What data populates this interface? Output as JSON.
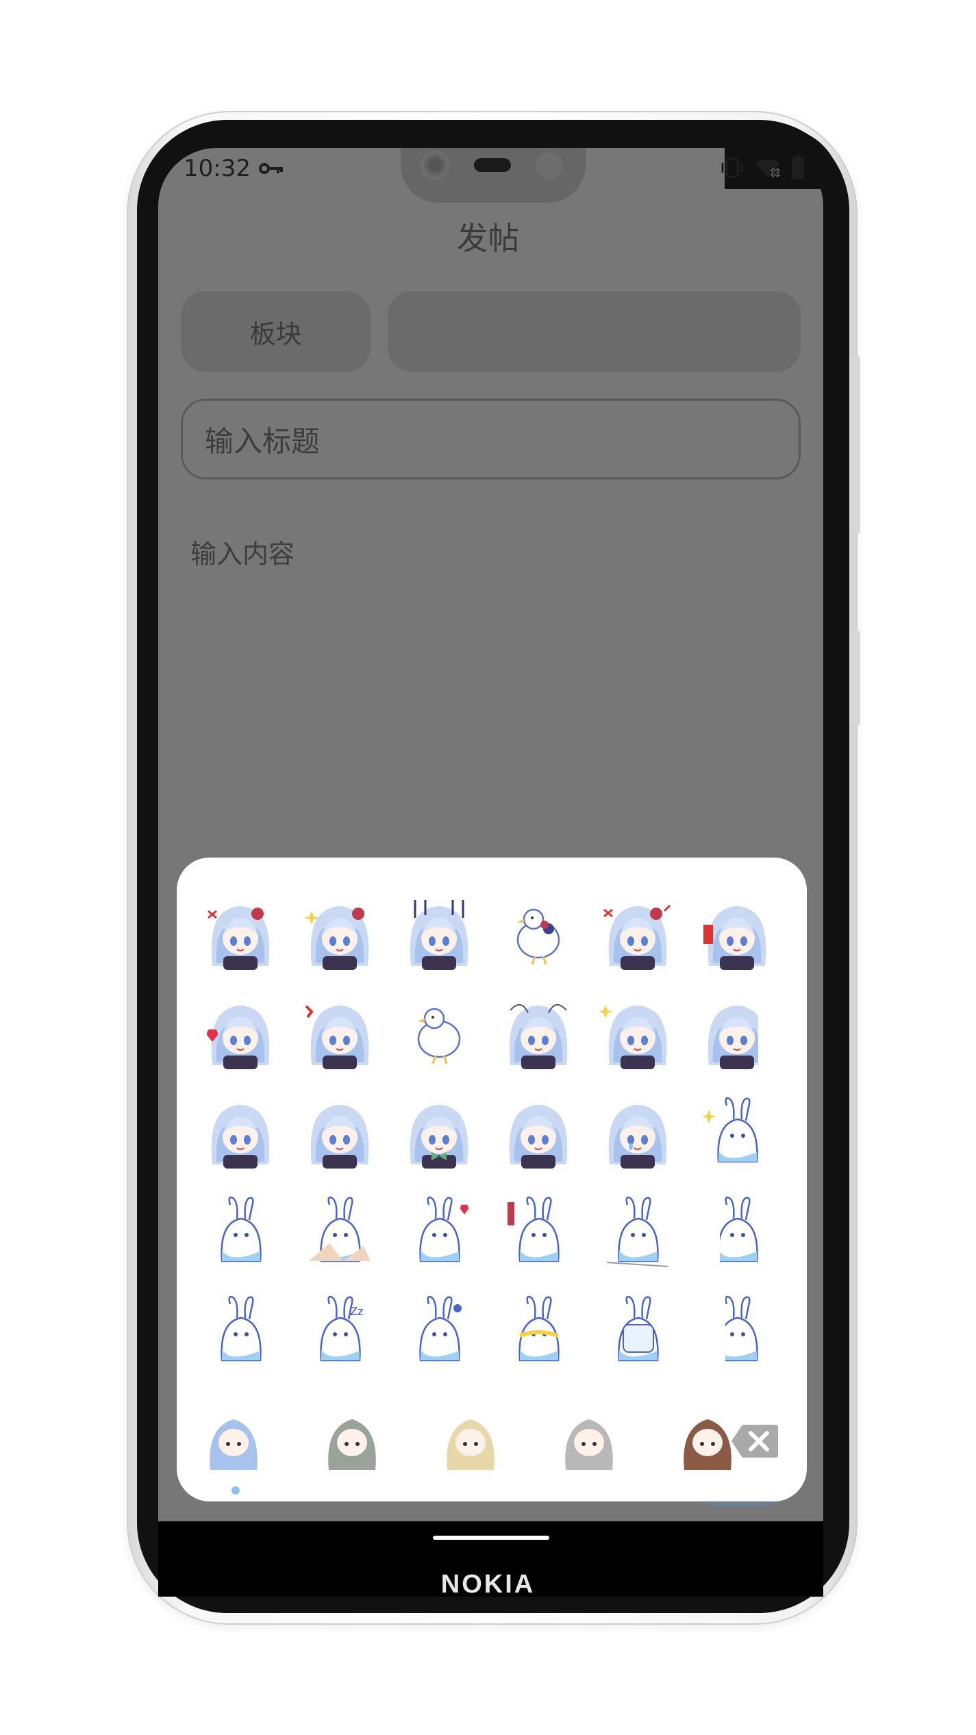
{
  "status_bar": {
    "time": "10:32",
    "icons": [
      "key-icon",
      "vibrate-icon",
      "wifi-off-icon",
      "battery-icon"
    ]
  },
  "header": {
    "title": "发帖"
  },
  "form": {
    "section_label": "板块",
    "title_placeholder": "输入标题",
    "content_placeholder": "输入内容"
  },
  "emoji_panel": {
    "grid_rows": [
      [
        "girl-angry",
        "girl-sparkle",
        "girl-shocked",
        "bird-bow",
        "girl-rage",
        "girl-gift"
      ],
      [
        "girl-heart",
        "girl-excited",
        "bird-plain",
        "girl-tangle",
        "girl-shy",
        "girl-peek"
      ],
      [
        "girl-smile",
        "girl-laugh",
        "girl-bowtie",
        "girl-blush",
        "girl-teary",
        "bunny-wave"
      ],
      [
        "bunny-sit",
        "bunny-crash",
        "bunny-heart",
        "bunny-torch",
        "bunny-stand",
        "bunny-peek"
      ],
      [
        "bunny-face",
        "bunny-sleep",
        "bunny-yawn",
        "bunny-cheer",
        "bunny-cube",
        "bunny-side"
      ]
    ],
    "categories": [
      "girl-category",
      "gray-girl-category",
      "blonde-girl-category",
      "office-category",
      "brown-girl-category"
    ],
    "backspace_icon": "backspace-icon",
    "accent_color": "#8fb6ea",
    "page_index": 1
  },
  "brand": {
    "name": "NOKIA"
  }
}
